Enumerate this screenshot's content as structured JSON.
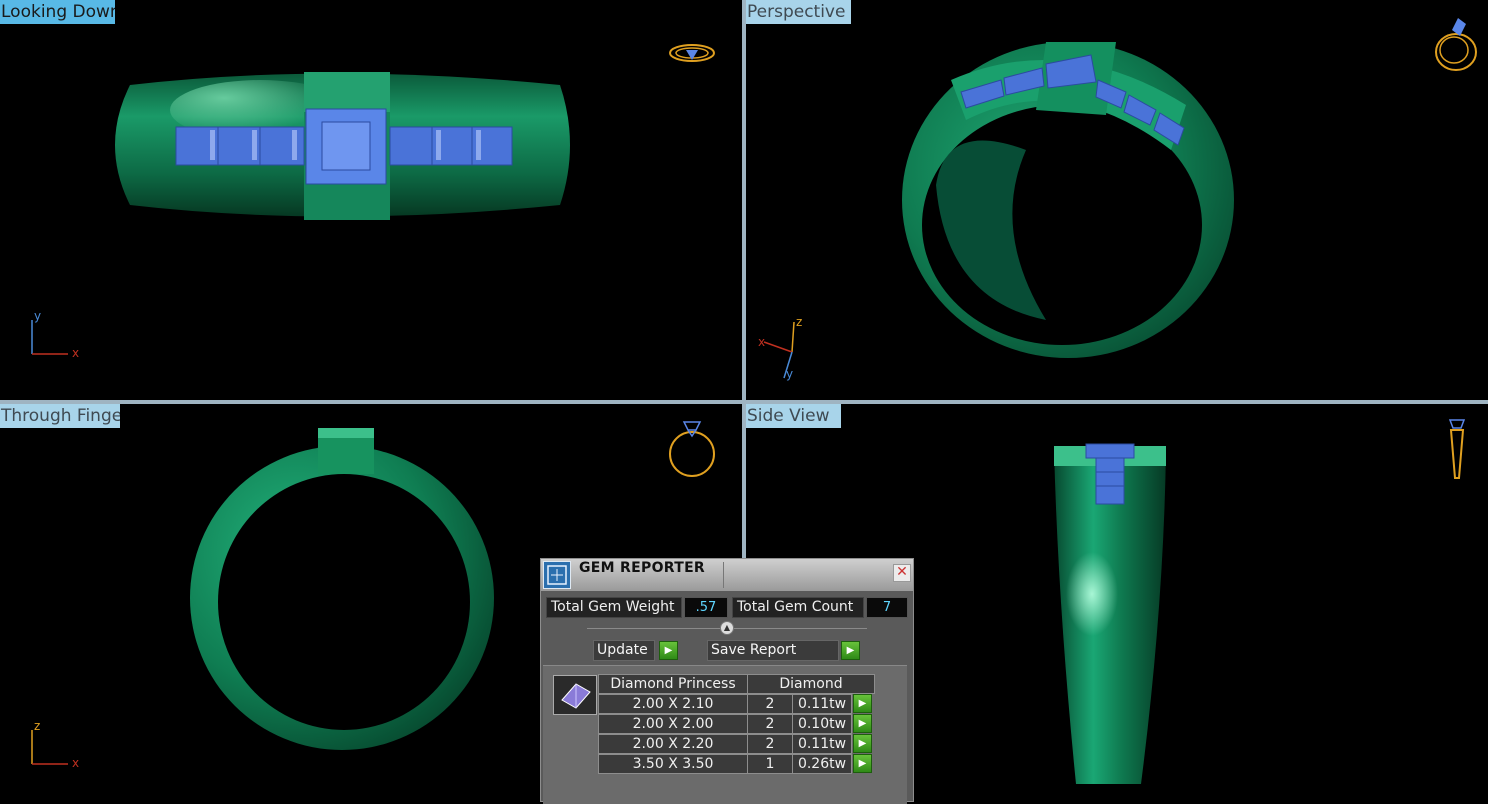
{
  "viewports": {
    "looking_down": {
      "title": "Looking Down",
      "axes": [
        "y",
        "x"
      ]
    },
    "perspective": {
      "title": "Perspective",
      "axes": [
        "z",
        "x",
        "y"
      ]
    },
    "through_finger": {
      "title": "Through Finger",
      "axes": [
        "z",
        "x"
      ]
    },
    "side_view": {
      "title": "Side View"
    }
  },
  "gem_reporter": {
    "title": "GEM REPORTER",
    "close_glyph": "✕",
    "total_gem_weight_label": "Total Gem Weight",
    "total_gem_weight_value": ".57",
    "total_gem_count_label": "Total Gem Count",
    "total_gem_count_value": "7",
    "update_label": "Update",
    "save_report_label": "Save Report",
    "go_glyph": "▶",
    "table": {
      "header_shape": "Diamond Princess",
      "header_type": "Diamond",
      "rows": [
        {
          "size": "2.00 X 2.10",
          "count": "2",
          "weight": "0.11tw"
        },
        {
          "size": "2.00 X 2.00",
          "count": "2",
          "weight": "0.10tw"
        },
        {
          "size": "2.00 X 2.20",
          "count": "2",
          "weight": "0.11tw"
        },
        {
          "size": "3.50 X 3.50",
          "count": "1",
          "weight": "0.26tw"
        }
      ]
    }
  },
  "colors": {
    "metal": "#117a50",
    "gem": "#4a73d8",
    "view_cube_icon": "#e0a020",
    "title_active": "#58b9e6",
    "title_inactive": "#a8d4ea"
  }
}
